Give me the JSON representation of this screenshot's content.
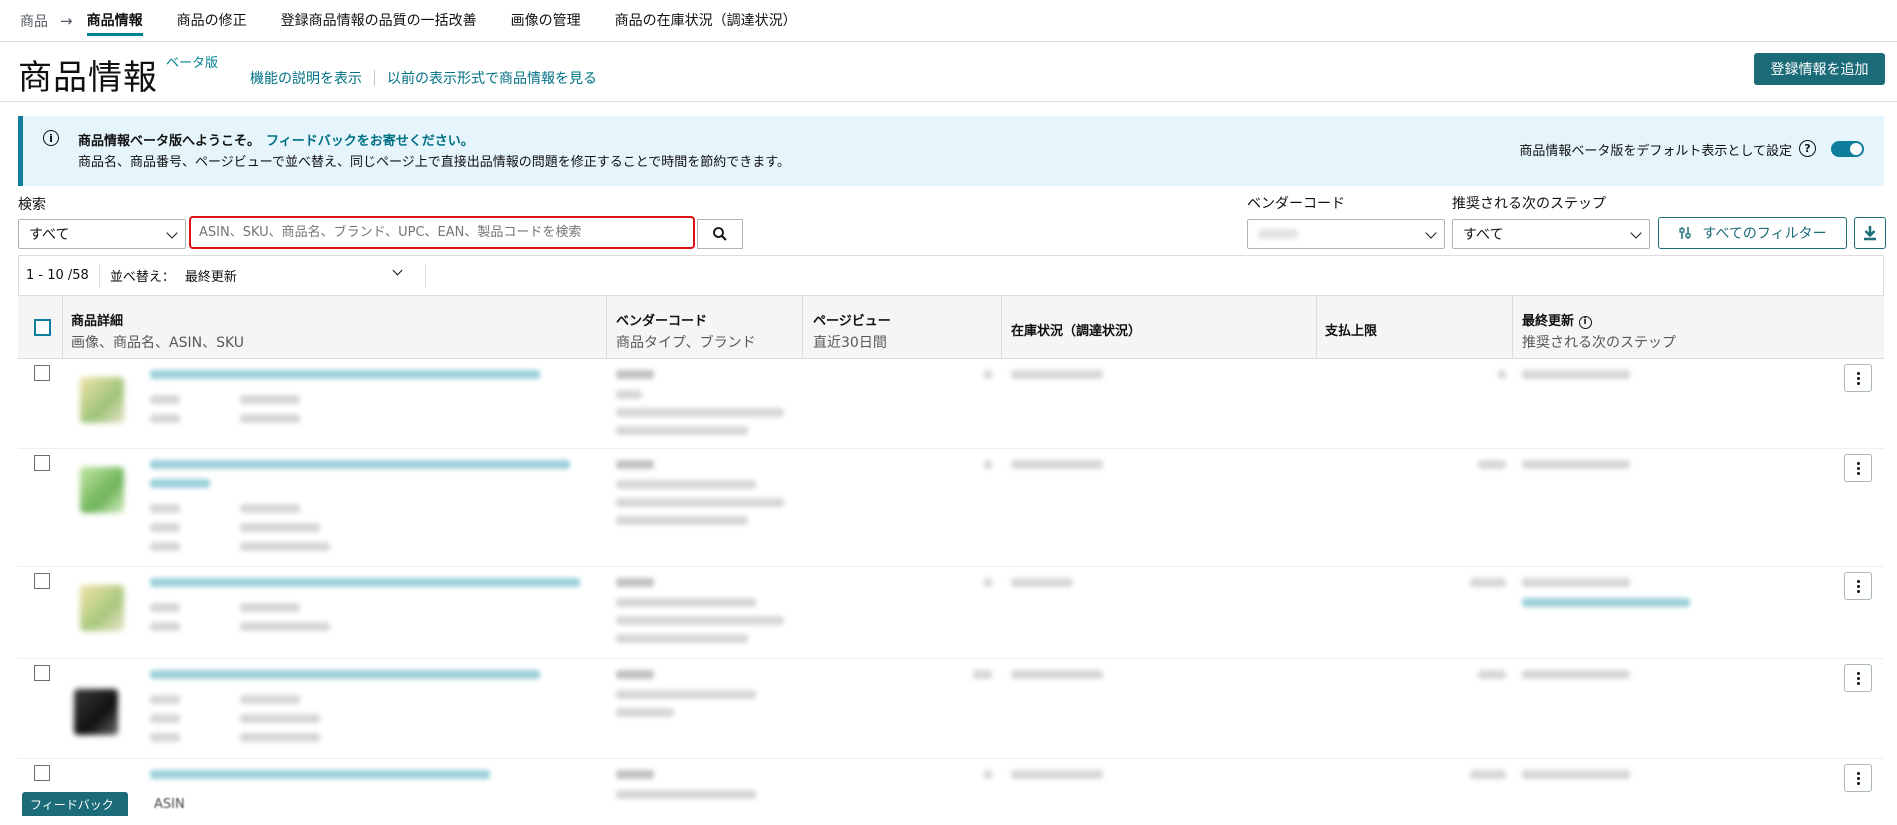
{
  "nav": {
    "root": "商品",
    "tabs": [
      {
        "label": "商品情報",
        "active": true
      },
      {
        "label": "商品の修正"
      },
      {
        "label": "登録商品情報の品質の一括改善"
      },
      {
        "label": "画像の管理"
      },
      {
        "label": "商品の在庫状況（調達状況）"
      }
    ]
  },
  "header": {
    "title": "商品情報",
    "beta": "ベータ版",
    "link_help": "機能の説明を表示",
    "link_old": "以前の表示形式で商品情報を見る",
    "add_button": "登録情報を追加"
  },
  "banner": {
    "headline": "商品情報ベータ版へようこそ。",
    "feedback_link": "フィードバックをお寄せください。",
    "body": "商品名、商品番号、ページビューで並べ替え、同じページ上で直接出品情報の問題を修正することで時間を節約できます。",
    "default_label": "商品情報ベータ版をデフォルト表示として設定",
    "toggle_on": true
  },
  "filters": {
    "search_label": "検索",
    "search_scope": "すべて",
    "search_placeholder": "ASIN、SKU、商品名、ブランド、UPC、EAN、製品コードを検索",
    "vendor_label": "ベンダーコード",
    "next_step_label": "推奨される次のステップ",
    "next_step_value": "すべて",
    "all_filters": "すべてのフィルター"
  },
  "results": {
    "count": "1 - 10 /58",
    "sort_label": "並べ替え：",
    "sort_value": "最終更新"
  },
  "columns": [
    {
      "title": "商品詳細",
      "sub": "画像、商品名、ASIN、SKU"
    },
    {
      "title": "ベンダーコード",
      "sub": "商品タイプ、ブランド"
    },
    {
      "title": "ページビュー",
      "sub": "直近30日間"
    },
    {
      "title": "在庫状況（調達状況）",
      "sub": ""
    },
    {
      "title": "支払上限",
      "sub": ""
    },
    {
      "title": "最終更新",
      "sub": "推奨される次のステップ"
    }
  ],
  "footer": {
    "feedback_tab": "フィードバック",
    "asin_peek": "ASIN"
  },
  "colors": {
    "accent": "#008296",
    "primary_button": "#1b6b78",
    "link": "#007185",
    "banner_bg": "#e6f4fb",
    "search_highlight": "#dd1111"
  }
}
